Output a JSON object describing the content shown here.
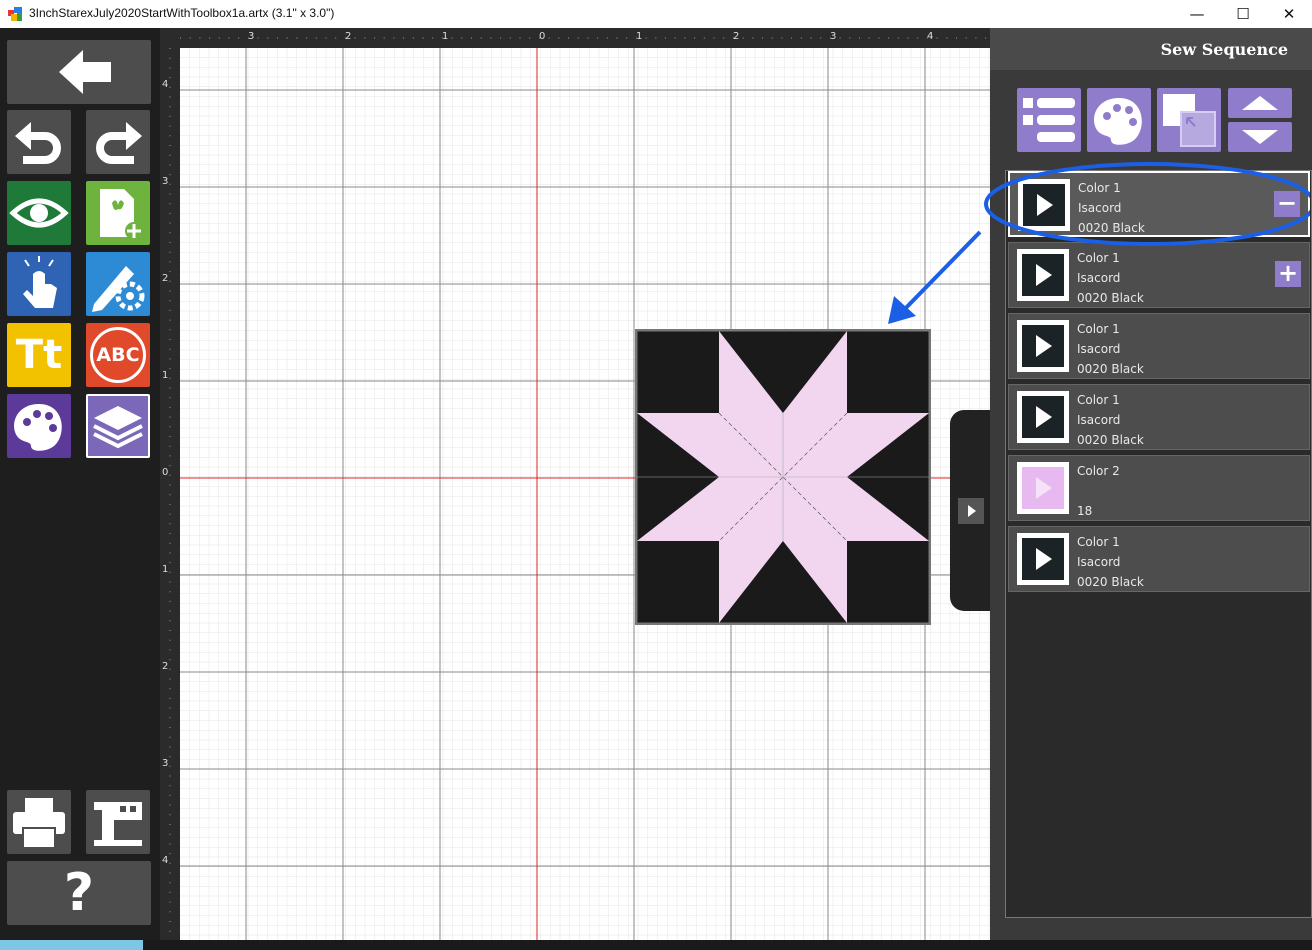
{
  "window": {
    "title": "3InchStarexJuly2020StartWithToolbox1a.artx (3.1\" x 3.0\")",
    "minimize_glyph": "—",
    "maximize_glyph": "☐",
    "close_glyph": "✕"
  },
  "toolbar": {
    "buttons": [
      {
        "name": "back-arrow-icon",
        "color": "#4d4d4d"
      },
      {
        "name": "undo-icon",
        "color": "#4d4d4d"
      },
      {
        "name": "redo-icon",
        "color": "#4d4d4d"
      },
      {
        "name": "view-eye-icon",
        "color": "#1f7a3a"
      },
      {
        "name": "add-design-icon",
        "color": "#6fb33f"
      },
      {
        "name": "select-touch-icon",
        "color": "#2f63b3"
      },
      {
        "name": "edit-settings-icon",
        "color": "#2d8bd6"
      },
      {
        "name": "text-icon",
        "color": "#f2c200"
      },
      {
        "name": "monogram-icon",
        "color": "#e04a2a"
      },
      {
        "name": "color-palette-icon",
        "color": "#5b3a9a"
      },
      {
        "name": "layers-icon",
        "color": "#7b68b8"
      },
      {
        "name": "print-icon",
        "color": "#4d4d4d"
      },
      {
        "name": "sewing-machine-icon",
        "color": "#4d4d4d"
      },
      {
        "name": "help-icon",
        "color": "#4d4d4d"
      }
    ],
    "text_icon_label": "Tt",
    "monogram_label": "ABC",
    "help_label": "?"
  },
  "ruler": {
    "top_labels": [
      "3",
      "2",
      "1",
      "0",
      "1",
      "2",
      "3",
      "4"
    ],
    "left_labels": [
      "4",
      "3",
      "2",
      "1",
      "0",
      "1",
      "2",
      "3",
      "4"
    ]
  },
  "panel": {
    "title": "Sew Sequence",
    "tools": [
      {
        "name": "list-view-icon"
      },
      {
        "name": "palette-icon"
      },
      {
        "name": "layer-order-icon"
      },
      {
        "name": "move-up-icon"
      },
      {
        "name": "move-down-icon"
      }
    ],
    "rows": [
      {
        "color": "Color 1",
        "brand": "Isacord",
        "thread": "0020 Black",
        "swatch": "#1c2326",
        "action": "−",
        "selected": true
      },
      {
        "color": "Color 1",
        "brand": "Isacord",
        "thread": "0020 Black",
        "swatch": "#1c2326",
        "action": "+",
        "selected": false
      },
      {
        "color": "Color 1",
        "brand": "Isacord",
        "thread": "0020 Black",
        "swatch": "#1c2326",
        "action": "",
        "selected": false
      },
      {
        "color": "Color 1",
        "brand": "Isacord",
        "thread": "0020 Black",
        "swatch": "#1c2326",
        "action": "",
        "selected": false
      },
      {
        "color": "Color 2",
        "brand": "",
        "thread": "18",
        "swatch": "#e8b8f0",
        "action": "",
        "selected": false
      },
      {
        "color": "Color 1",
        "brand": "Isacord",
        "thread": "0020 Black",
        "swatch": "#1c2326",
        "action": "",
        "selected": false
      }
    ]
  },
  "colors": {
    "accent": "#8f7ccb",
    "annotation_blue": "#1a5fe6",
    "design_black": "#1a1a1a",
    "design_pink": "#f2d6f0",
    "center_line": "#e02020"
  }
}
